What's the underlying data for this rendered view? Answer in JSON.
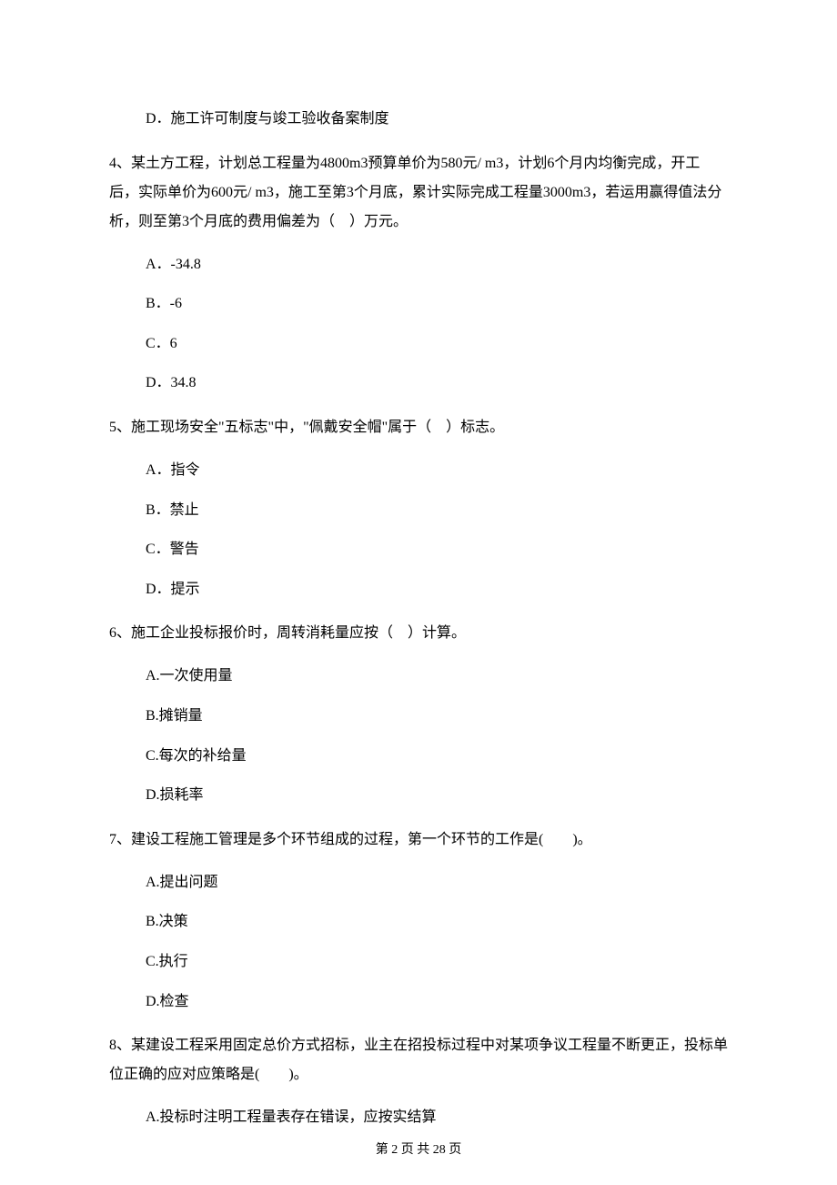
{
  "q3": {
    "optD": "D．施工许可制度与竣工验收备案制度"
  },
  "q4": {
    "stem": "4、某土方工程，计划总工程量为4800m3预算单价为580元/ m3，计划6个月内均衡完成，开工后，实际单价为600元/ m3，施工至第3个月底，累计实际完成工程量3000m3，若运用赢得值法分析，则至第3个月底的费用偏差为（　）万元。",
    "optA": "A．-34.8",
    "optB": "B．-6",
    "optC": "C．6",
    "optD": "D．34.8"
  },
  "q5": {
    "stem": "5、施工现场安全\"五标志\"中，\"佩戴安全帽\"属于（　）标志。",
    "optA": "A．指令",
    "optB": "B．禁止",
    "optC": "C．警告",
    "optD": "D．提示"
  },
  "q6": {
    "stem": "6、施工企业投标报价时，周转消耗量应按（　）计算。",
    "optA": "A.一次使用量",
    "optB": "B.摊销量",
    "optC": "C.每次的补给量",
    "optD": "D.损耗率"
  },
  "q7": {
    "stem": "7、建设工程施工管理是多个环节组成的过程，第一个环节的工作是(　　)。",
    "optA": "A.提出问题",
    "optB": "B.决策",
    "optC": "C.执行",
    "optD": "D.检查"
  },
  "q8": {
    "stem": "8、某建设工程采用固定总价方式招标，业主在招投标过程中对某项争议工程量不断更正，投标单位正确的应对应策略是(　　)。",
    "optA": "A.投标时注明工程量表存在错误，应按实结算"
  },
  "footer": "第 2 页 共 28 页"
}
